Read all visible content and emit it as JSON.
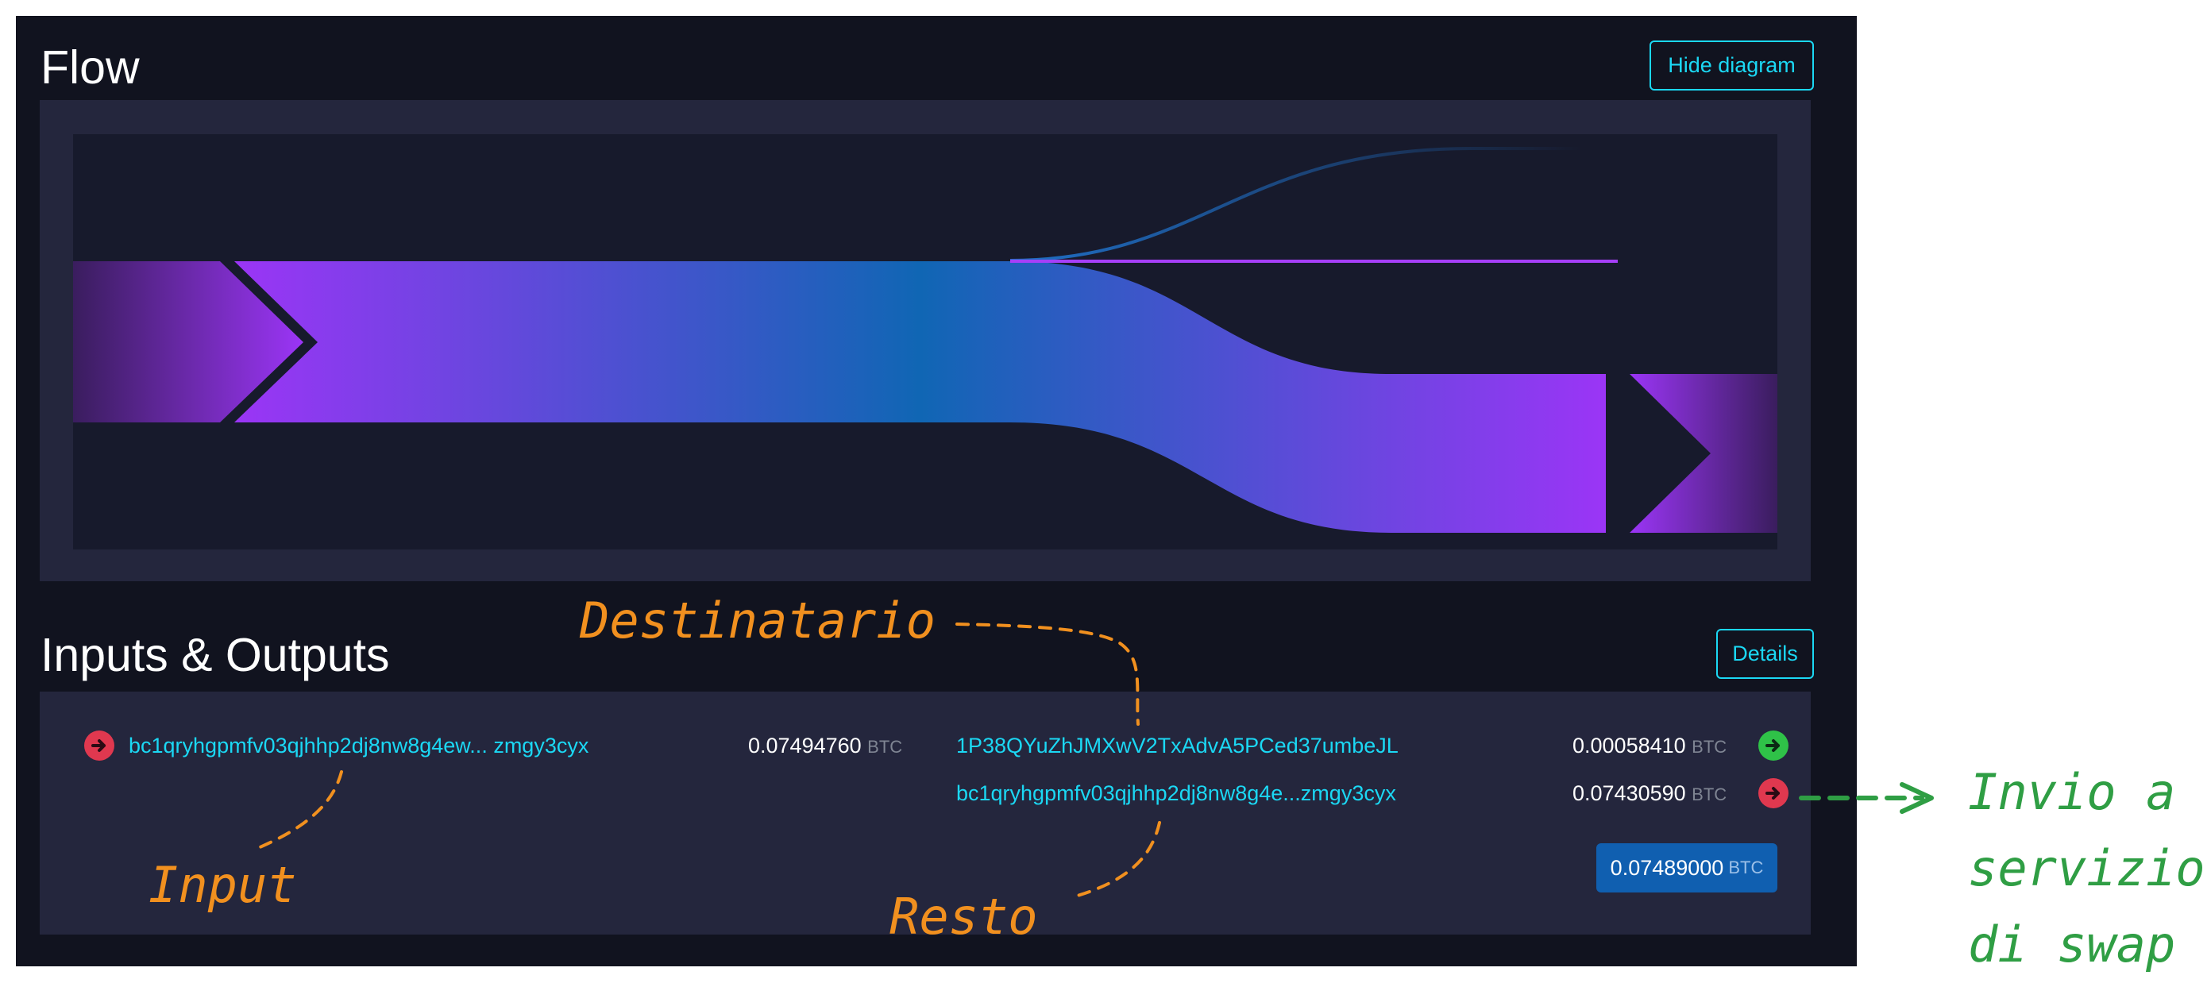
{
  "flow": {
    "title": "Flow",
    "hide_button": "Hide diagram"
  },
  "io": {
    "title": "Inputs & Outputs",
    "details_button": "Details",
    "inputs": [
      {
        "address": "bc1qryhgpmfv03qjhhp2dj8nw8g4ew... zmgy3cyx",
        "amount": "0.07494760",
        "unit": "BTC",
        "indicator": "arrow-right-red-icon"
      }
    ],
    "outputs": [
      {
        "address": "1P38QYuZhJMXwV2TxAdvA5PCed37umbeJL",
        "amount": "0.00058410",
        "unit": "BTC",
        "indicator": "arrow-right-green-icon"
      },
      {
        "address": "bc1qryhgpmfv03qjhhp2dj8nw8g4e...zmgy3cyx",
        "amount": "0.07430590",
        "unit": "BTC",
        "indicator": "arrow-right-red-icon"
      }
    ],
    "total": {
      "amount": "0.07489000",
      "unit": "BTC"
    }
  },
  "annotations": {
    "destinatario": "Destinatario",
    "input": "Input",
    "resto": "Resto",
    "invio_line1": "Invio a",
    "invio_line2": "servizio",
    "invio_line3": "di swap"
  },
  "colors": {
    "panel_bg": "#11131f",
    "box_bg": "#24263d",
    "link": "#1bd8f4",
    "flow_purple": "#9b35f6",
    "flow_blue": "#1066b4",
    "total_bg": "#105fb0",
    "green": "#2fc248",
    "red": "#e0384f",
    "annotation_orange": "#f1901f",
    "annotation_green": "#2f9e44"
  }
}
